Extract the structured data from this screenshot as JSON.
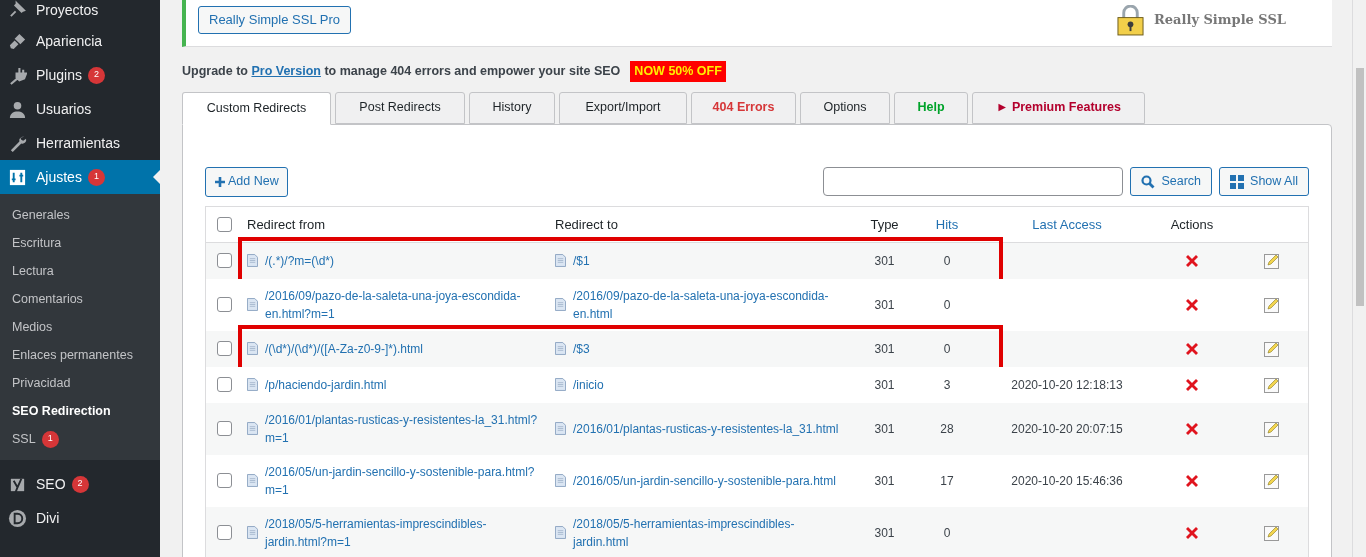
{
  "sidebar": {
    "items": [
      {
        "label": "Proyectos",
        "selected": false
      },
      {
        "label": "Apariencia",
        "selected": false
      },
      {
        "label": "Plugins",
        "badge": "2",
        "selected": false
      },
      {
        "label": "Usuarios",
        "selected": false
      },
      {
        "label": "Herramientas",
        "selected": false
      },
      {
        "label": "Ajustes",
        "badge": "1",
        "selected": true,
        "children": [
          {
            "label": "Generales",
            "selected": false
          },
          {
            "label": "Escritura",
            "selected": false
          },
          {
            "label": "Lectura",
            "selected": false
          },
          {
            "label": "Comentarios",
            "selected": false
          },
          {
            "label": "Medios",
            "selected": false
          },
          {
            "label": "Enlaces permanentes",
            "selected": false
          },
          {
            "label": "Privacidad",
            "selected": false
          },
          {
            "label": "SEO Redirection",
            "selected": true
          },
          {
            "label": "SSL",
            "selected": false,
            "badge": "1"
          }
        ]
      },
      {
        "label": "SEO",
        "badge": "2",
        "selected": false
      },
      {
        "label": "Divi",
        "selected": false
      }
    ]
  },
  "notice": {
    "button": "Really Simple SSL Pro",
    "logo_text": "Really Simple SSL"
  },
  "upgrade": {
    "before": "Upgrade to",
    "link": "Pro Version",
    "after": "to manage 404 errors and empower your site SEO",
    "offer": "NOW 50% OFF"
  },
  "tabs": [
    {
      "label": "Custom Redirects",
      "kind": "normal",
      "selected": true
    },
    {
      "label": "Post Redirects",
      "kind": "normal",
      "selected": false
    },
    {
      "label": "History",
      "kind": "normal",
      "selected": false
    },
    {
      "label": "Export/Import",
      "kind": "normal",
      "selected": false
    },
    {
      "label": "404 Errors",
      "kind": "error",
      "selected": false
    },
    {
      "label": "Options",
      "kind": "normal",
      "selected": false
    },
    {
      "label": "Help",
      "kind": "help",
      "selected": false
    },
    {
      "label": "► Premium Features",
      "kind": "premium",
      "selected": false
    }
  ],
  "toolbar": {
    "add_button": "Add New",
    "search_button": "Search",
    "show_all_button": "Show All"
  },
  "table": {
    "select_all_checked": false,
    "columns": [
      {
        "label": "Redirect from",
        "sortable": false
      },
      {
        "label": "Redirect to",
        "sortable": false
      },
      {
        "label": "Type",
        "sortable": false
      },
      {
        "label": "Hits",
        "sortable": true
      },
      {
        "label": "Last Access",
        "sortable": true
      },
      {
        "label": "Actions",
        "sortable": false
      }
    ],
    "rows": [
      {
        "from": "/(.*)/?m=(\\d*)",
        "to": "/$1",
        "type": "301",
        "hits": "0",
        "checked": false,
        "highlighted": true
      },
      {
        "from": "/2016/09/pazo-de-la-saleta-una-joya-escondida-en.html?m=1",
        "to": "/2016/09/pazo-de-la-saleta-una-joya-escondida-en.html",
        "type": "301",
        "hits": "0",
        "checked": false,
        "highlighted": false
      },
      {
        "from": "/(\\d*)/(\\d*)/([A-Za-z0-9-]*).html",
        "to": "/$3",
        "type": "301",
        "hits": "0",
        "checked": false,
        "highlighted": true
      },
      {
        "from": "/p/haciendo-jardin.html",
        "to": "/inicio",
        "type": "301",
        "hits": "3",
        "last_access": "2020-10-20 12:18:13",
        "checked": false,
        "highlighted": false
      },
      {
        "from": "/2016/01/plantas-rusticas-y-resistentes-la_31.html?m=1",
        "to": "/2016/01/plantas-rusticas-y-resistentes-la_31.html",
        "type": "301",
        "hits": "28",
        "last_access": "2020-10-20 20:07:15",
        "checked": false,
        "highlighted": false
      },
      {
        "from": "/2016/05/un-jardin-sencillo-y-sostenible-para.html?m=1",
        "to": "/2016/05/un-jardin-sencillo-y-sostenible-para.html",
        "type": "301",
        "hits": "17",
        "last_access": "2020-10-20 15:46:36",
        "checked": false,
        "highlighted": false
      },
      {
        "from": "/2018/05/5-herramientas-imprescindibles-jardin.html?m=1",
        "to": "/2018/05/5-herramientas-imprescindibles-jardin.html",
        "type": "301",
        "hits": "0",
        "checked": false,
        "highlighted": false
      }
    ]
  }
}
